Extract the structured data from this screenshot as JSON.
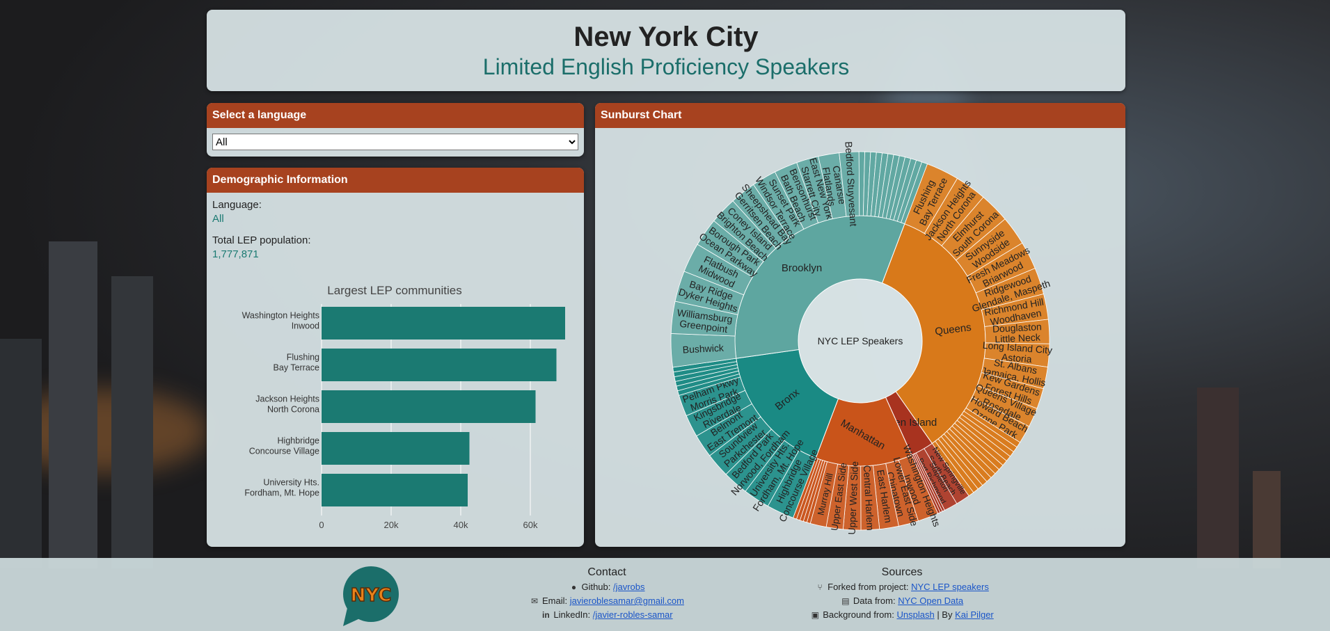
{
  "header": {
    "title": "New York City",
    "subtitle": "Limited English Proficiency Speakers"
  },
  "language_panel": {
    "title": "Select a language",
    "selected": "All",
    "options": [
      "All"
    ]
  },
  "demographics": {
    "title": "Demographic Information",
    "language_label": "Language:",
    "language_value": "All",
    "population_label": "Total LEP population:",
    "population_value": "1,777,871"
  },
  "chart_data": [
    {
      "type": "bar",
      "orientation": "horizontal",
      "title": "Largest LEP communities",
      "categories": [
        [
          "Washington Heights",
          "Inwood"
        ],
        [
          "Flushing",
          "Bay Terrace"
        ],
        [
          "Jackson Heights",
          "North Corona"
        ],
        [
          "Highbridge",
          "Concourse Village"
        ],
        [
          "University Hts.",
          "Fordham, Mt. Hope"
        ]
      ],
      "values": [
        70000,
        67500,
        61500,
        42500,
        42000
      ],
      "xlim": [
        0,
        70000
      ],
      "xticks": [
        0,
        20000,
        40000,
        60000
      ],
      "xtick_labels": [
        "0",
        "20k",
        "40k",
        "60k"
      ],
      "color": "#1b7a72",
      "grid": true
    },
    {
      "type": "sunburst",
      "panel_title": "Sunburst Chart",
      "root": "NYC LEP Speakers",
      "boroughs": [
        {
          "name": "Queens",
          "share": 0.345,
          "color": "#d8791a",
          "labels": [
            [
              "Flushing",
              "Bay Terrace"
            ],
            [
              "Jackson Heights",
              "North Corona"
            ],
            [
              "Elmhurst",
              "South Corona"
            ],
            [
              "Sunnyside",
              "Woodside"
            ],
            [
              "Fresh Meadows",
              "Briarwood"
            ],
            [
              "Ridgewood",
              "Glendale, Maspeth"
            ],
            [
              "Richmond Hill",
              "Woodhaven"
            ],
            [
              "Douglaston",
              "Little Neck"
            ],
            [
              "Long Island City",
              "Astoria"
            ],
            [
              "St. Albans",
              "Jamaica, Hollis"
            ],
            [
              "Kew Gardens",
              "Forest Hills"
            ],
            [
              "Queens Village",
              "Rosedale"
            ],
            [
              "Howard Beach",
              "Ozone Park"
            ]
          ]
        },
        {
          "name": "Staten Island",
          "share": 0.03,
          "color": "#a8331f",
          "labels": [
            [
              "New Springville",
              "South Beach"
            ],
            [
              "Stapleton",
              "Port Richmond"
            ]
          ]
        },
        {
          "name": "Manhattan",
          "share": 0.125,
          "color": "#c9541a",
          "labels": [
            [
              "Washington Heights",
              "Inwood"
            ],
            [
              "Lower East Side",
              "Chinatown"
            ],
            [
              "East Harlem"
            ],
            [
              "Central Harlem"
            ],
            [
              "Upper West Side"
            ],
            [
              "Upper East Side"
            ],
            [
              "Murray Hill"
            ]
          ]
        },
        {
          "name": "Bronx",
          "share": 0.17,
          "color": "#1a8a84",
          "labels": [
            [
              "Highbridge",
              "Concourse Village"
            ],
            [
              "University Hts.",
              "Fordham, Mt. Hope"
            ],
            [
              "Bedford Park",
              "Norwood, Fordham"
            ],
            [
              "Soundview",
              "Parkchester"
            ],
            [
              "Belmont",
              "East Tremont"
            ],
            [
              "Kingsbridge",
              "Riverdale"
            ],
            [
              "Pelham Pkwy",
              "Morris Park"
            ]
          ]
        },
        {
          "name": "Brooklyn",
          "share": 0.33,
          "color": "#5ea6a0",
          "labels": [
            [
              "Bushwick"
            ],
            [
              "Williamsburg",
              "Greenpoint"
            ],
            [
              "Bay Ridge",
              "Dyker Heights"
            ],
            [
              "Flatbush",
              "Midwood"
            ],
            [
              "Borough Park",
              "Ocean Parkway"
            ],
            [
              "Coney Island",
              "Brighton Beach"
            ],
            [
              "Sheepshead Bay",
              "Gerritsen Beach"
            ],
            [
              "Sunset Park",
              "Windsor Terrace"
            ],
            [
              "Bensonhurst",
              "Bath Beach"
            ],
            [
              "East New York",
              "Starrett City"
            ],
            [
              "Canarsie",
              "Flatlands"
            ],
            [
              "Bedford Stuyvesant"
            ]
          ]
        }
      ]
    }
  ],
  "sunburst_panel": {
    "title": "Sunburst Chart"
  },
  "footer": {
    "logo_text": "NYC",
    "contact": {
      "title": "Contact",
      "github_label": "Github:",
      "github_link": "/javrobs",
      "email_label": "Email:",
      "email_link": "javieroblesamar@gmail.com",
      "linkedin_label": "LinkedIn:",
      "linkedin_link": "/javier-robles-samar"
    },
    "sources": {
      "title": "Sources",
      "forked_label": "Forked from project:",
      "forked_link": "NYC LEP speakers",
      "data_label": "Data from:",
      "data_link": "NYC Open Data",
      "bg_label": "Background from:",
      "bg_link": "Unsplash",
      "sep": "| By",
      "author_link": "Kai Pilger"
    }
  }
}
